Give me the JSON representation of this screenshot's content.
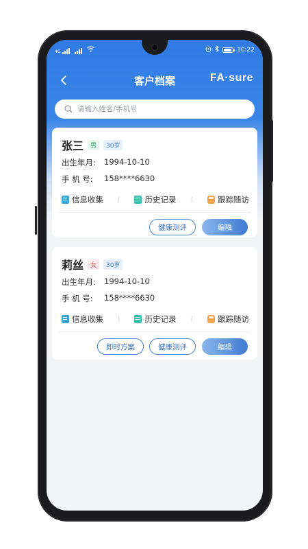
{
  "status_bar": {
    "left_text": "4G",
    "time": "10:22"
  },
  "header": {
    "title": "客户档案",
    "logo": "FA·sure"
  },
  "search": {
    "placeholder": "请输入姓名/手机号"
  },
  "labels": {
    "birth": "出生年月:",
    "phone": "手 机 号:",
    "info_collect": "信息收集",
    "history": "历史记录",
    "follow_up": "跟踪随访",
    "instant_plan": "即时方案",
    "health_eval": "健康测评",
    "edit": "编辑"
  },
  "customers": [
    {
      "name": "张三",
      "gender": "男",
      "age": "30岁",
      "birth": "1994-10-10",
      "phone": "158****6630"
    },
    {
      "name": "莉丝",
      "gender": "女",
      "age": "30岁",
      "birth": "1994-10-10",
      "phone": "158****6630"
    }
  ],
  "icons": [
    "back-icon",
    "search-icon",
    "info-collect-icon",
    "history-icon",
    "follow-up-icon"
  ],
  "colors": {
    "primary": "#2f7be3",
    "male_tag": "#3aa36a",
    "female_tag": "#e05b63"
  }
}
